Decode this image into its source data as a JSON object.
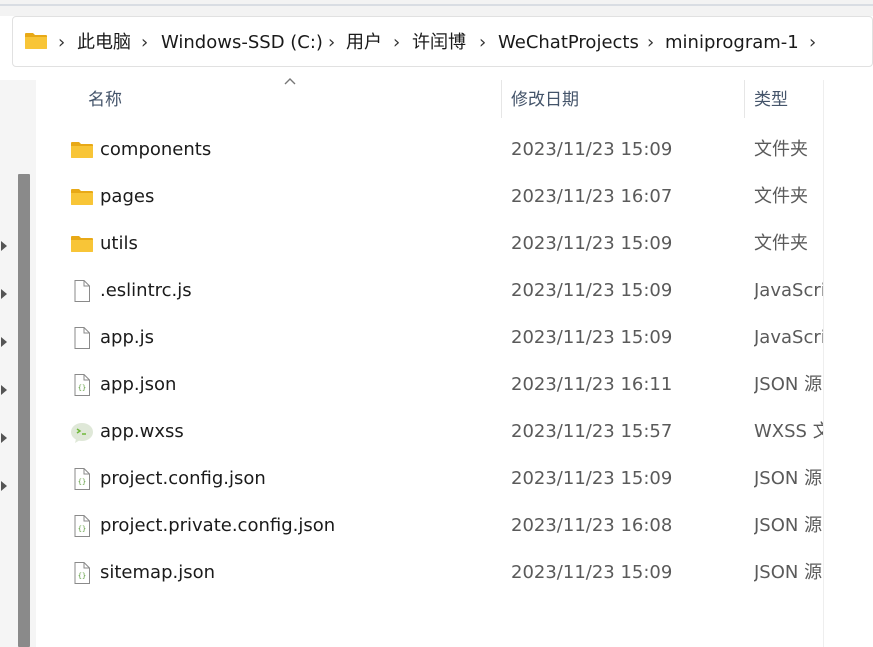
{
  "breadcrumb": {
    "items": [
      "此电脑",
      "Windows-SSD (C:)",
      "用户",
      "许闰博",
      "WeChatProjects",
      "miniprogram-1"
    ],
    "separator": "›"
  },
  "columns": {
    "name": "名称",
    "modified": "修改日期",
    "type": "类型"
  },
  "files": [
    {
      "name": "components",
      "modified": "2023/11/23 15:09",
      "type": "文件夹",
      "icon": "folder-icon"
    },
    {
      "name": "pages",
      "modified": "2023/11/23 16:07",
      "type": "文件夹",
      "icon": "folder-icon"
    },
    {
      "name": "utils",
      "modified": "2023/11/23 15:09",
      "type": "文件夹",
      "icon": "folder-icon"
    },
    {
      "name": ".eslintrc.js",
      "modified": "2023/11/23 15:09",
      "type": "JavaScri",
      "icon": "document-icon"
    },
    {
      "name": "app.js",
      "modified": "2023/11/23 15:09",
      "type": "JavaScri",
      "icon": "document-icon"
    },
    {
      "name": "app.json",
      "modified": "2023/11/23 16:11",
      "type": "JSON 源",
      "icon": "json-file-icon"
    },
    {
      "name": "app.wxss",
      "modified": "2023/11/23 15:57",
      "type": "WXSS 文",
      "icon": "wechat-devtools-icon"
    },
    {
      "name": "project.config.json",
      "modified": "2023/11/23 15:09",
      "type": "JSON 源",
      "icon": "json-file-icon"
    },
    {
      "name": "project.private.config.json",
      "modified": "2023/11/23 16:08",
      "type": "JSON 源",
      "icon": "json-file-icon"
    },
    {
      "name": "sitemap.json",
      "modified": "2023/11/23 15:09",
      "type": "JSON 源",
      "icon": "json-file-icon"
    }
  ],
  "colors": {
    "folder": "#f8c537",
    "folder_dark": "#e8a917",
    "json_green": "#5a9a3a",
    "wechat_green": "#6fb83a"
  }
}
